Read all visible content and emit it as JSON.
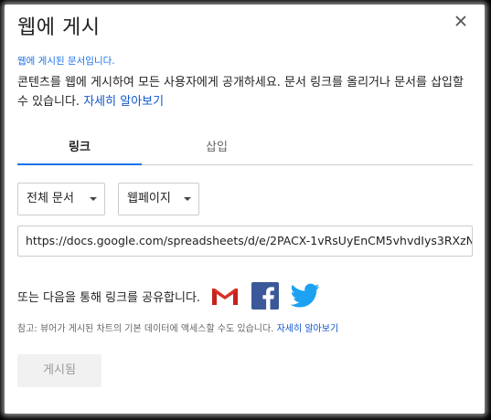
{
  "dialog": {
    "title": "웹에 게시",
    "status": "웹에 게시된 문서입니다.",
    "description": "콘텐츠를 웹에 게시하여 모든 사용자에게 공개하세요. 문서 링크를 올리거나 문서를 삽입할 수 있습니다.",
    "learn_more": "자세히 알아보기"
  },
  "tabs": [
    {
      "label": "링크",
      "active": true
    },
    {
      "label": "삽입",
      "active": false
    }
  ],
  "selectors": {
    "scope": "전체 문서",
    "format": "웹페이지"
  },
  "link": {
    "url": "https://docs.google.com/spreadsheets/d/e/2PACX-1vRsUyEnCM5vhvdIys3RXzN"
  },
  "share": {
    "text": "또는 다음을 통해 링크를 공유합니다.",
    "icons": [
      "gmail-icon",
      "facebook-icon",
      "twitter-icon"
    ]
  },
  "note": {
    "prefix": "참고:",
    "text": " 뷰어가 게시된 차트의 기본 데이터에 액세스할 수도 있습니다. ",
    "learn_more": "자세히 알아보기"
  },
  "publish_button": {
    "label": "게시됨"
  },
  "colors": {
    "accent": "#1a73e8",
    "link": "#1155cc",
    "facebook": "#3b5998",
    "twitter": "#1da1f2",
    "gmail_red": "#d93025"
  }
}
